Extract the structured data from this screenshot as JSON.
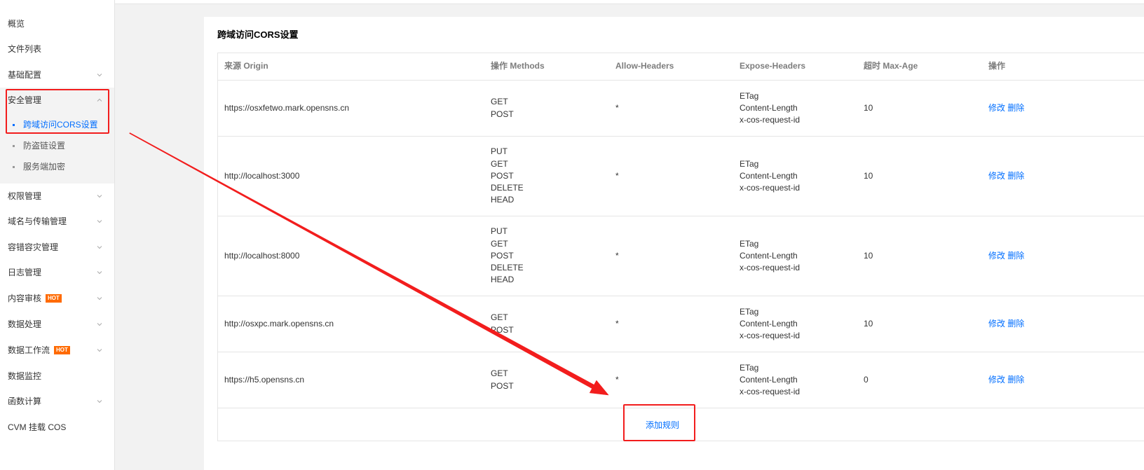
{
  "colors": {
    "accent": "#006eff",
    "hot_badge": "#ff6a00",
    "annotation": "#f21d1d",
    "text": "#333333"
  },
  "sidebar": {
    "items": [
      {
        "label": "概览"
      },
      {
        "label": "文件列表"
      },
      {
        "label": "基础配置"
      },
      {
        "label": "安全管理",
        "expanded": true,
        "children": [
          {
            "label": "跨域访问CORS设置",
            "active": true
          },
          {
            "label": "防盗链设置"
          },
          {
            "label": "服务端加密"
          }
        ]
      },
      {
        "label": "权限管理"
      },
      {
        "label": "域名与传输管理"
      },
      {
        "label": "容错容灾管理"
      },
      {
        "label": "日志管理"
      },
      {
        "label": "内容审核",
        "badge": "HOT"
      },
      {
        "label": "数据处理"
      },
      {
        "label": "数据工作流",
        "badge": "HOT"
      },
      {
        "label": "数据监控"
      },
      {
        "label": "函数计算"
      },
      {
        "label": "CVM 挂载 COS"
      }
    ]
  },
  "panel": {
    "title": "跨域访问CORS设置"
  },
  "table": {
    "headers": [
      "来源 Origin",
      "操作 Methods",
      "Allow-Headers",
      "Expose-Headers",
      "超时 Max-Age",
      "操作"
    ],
    "actions": {
      "edit": "修改",
      "delete": "删除"
    },
    "rows": [
      {
        "origin": "https://osxfetwo.mark.opensns.cn",
        "methods": [
          "GET",
          "POST"
        ],
        "allow_headers": "*",
        "expose_headers": [
          "ETag",
          "Content-Length",
          "x-cos-request-id"
        ],
        "max_age": "10"
      },
      {
        "origin": "http://localhost:3000",
        "methods": [
          "PUT",
          "GET",
          "POST",
          "DELETE",
          "HEAD"
        ],
        "allow_headers": "*",
        "expose_headers": [
          "ETag",
          "Content-Length",
          "x-cos-request-id"
        ],
        "max_age": "10"
      },
      {
        "origin": "http://localhost:8000",
        "methods": [
          "PUT",
          "GET",
          "POST",
          "DELETE",
          "HEAD"
        ],
        "allow_headers": "*",
        "expose_headers": [
          "ETag",
          "Content-Length",
          "x-cos-request-id"
        ],
        "max_age": "10"
      },
      {
        "origin": "http://osxpc.mark.opensns.cn",
        "methods": [
          "GET",
          "POST"
        ],
        "allow_headers": "*",
        "expose_headers": [
          "ETag",
          "Content-Length",
          "x-cos-request-id"
        ],
        "max_age": "10"
      },
      {
        "origin": "https://h5.opensns.cn",
        "methods": [
          "GET",
          "POST"
        ],
        "allow_headers": "*",
        "expose_headers": [
          "ETag",
          "Content-Length",
          "x-cos-request-id"
        ],
        "max_age": "0"
      }
    ],
    "add_rule_label": "添加规则"
  }
}
